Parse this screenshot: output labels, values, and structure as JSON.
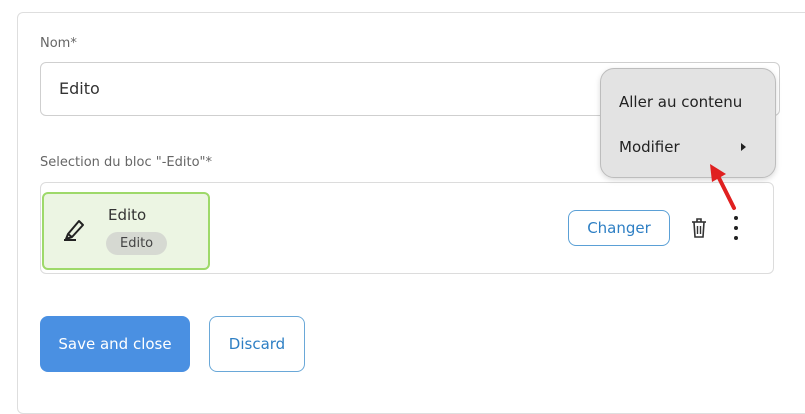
{
  "form": {
    "name_label": "Nom*",
    "name_value": "Edito",
    "block_label": "Selection du bloc \"-Edito\"*"
  },
  "block": {
    "title": "Edito",
    "badge": "Edito",
    "icon": "pen-icon",
    "change_label": "Changer",
    "delete_icon": "trash-icon",
    "more_icon": "more-vertical-icon"
  },
  "context_menu": {
    "items": [
      {
        "label": "Aller au contenu"
      },
      {
        "label": "Modifier",
        "has_submenu": true
      }
    ]
  },
  "actions": {
    "save_label": "Save and close",
    "discard_label": "Discard"
  },
  "colors": {
    "primary": "#4a90e2",
    "accent_text": "#2e7fc4",
    "block_border": "#9ed96a",
    "block_bg": "#ecf5e3",
    "annotation_arrow": "#e02020"
  }
}
